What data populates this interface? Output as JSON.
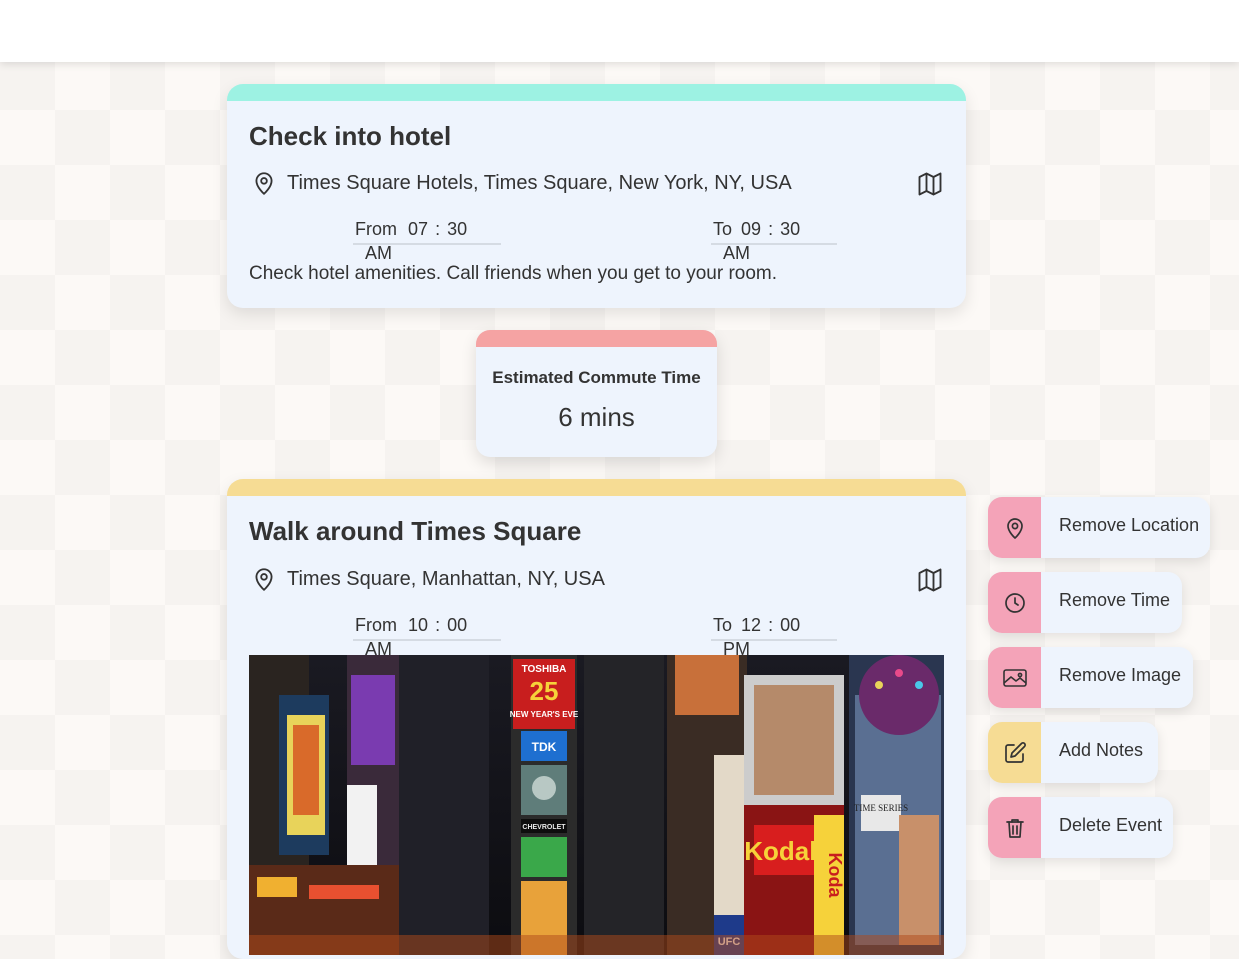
{
  "events": [
    {
      "title": "Check into hotel",
      "location": "Times Square Hotels, Times Square, New York, NY, USA",
      "from": {
        "label": "From",
        "hour": "07",
        "minute": "30",
        "ampm": "AM"
      },
      "to": {
        "label": "To",
        "hour": "09",
        "minute": "30",
        "ampm": "AM"
      },
      "notes": "Check hotel amenities. Call friends when you get to your room.",
      "accent": "#9df2e3"
    },
    {
      "title": "Walk around Times Square",
      "location": "Times Square, Manhattan, NY, USA",
      "from": {
        "label": "From",
        "hour": "10",
        "minute": "00",
        "ampm": "AM"
      },
      "to": {
        "label": "To",
        "hour": "12",
        "minute": "00",
        "ampm": "PM"
      },
      "accent": "#f6dc94",
      "image_signs": {
        "toshiba": "TOSHIBA",
        "number": "25",
        "new_years": "NEW YEAR'S EVE",
        "tdk": "TDK",
        "chevrolet": "CHEVROLET",
        "kodak": "Kodak",
        "kodak_vertical": "Koda",
        "ufc": "UFC",
        "time_series": "TIME SERIES"
      }
    }
  ],
  "commute": {
    "label": "Estimated Commute Time",
    "value": "6 mins",
    "accent": "#f5a3a3"
  },
  "actions": [
    {
      "label": "Remove Location",
      "icon": "map-pin-icon",
      "color": "#f4a3b8"
    },
    {
      "label": "Remove Time",
      "icon": "clock-icon",
      "color": "#f4a3b8"
    },
    {
      "label": "Remove Image",
      "icon": "image-icon",
      "color": "#f4a3b8"
    },
    {
      "label": "Add Notes",
      "icon": "edit-icon",
      "color": "#f6dc94"
    },
    {
      "label": "Delete Event",
      "icon": "trash-icon",
      "color": "#f4a3b8"
    }
  ]
}
